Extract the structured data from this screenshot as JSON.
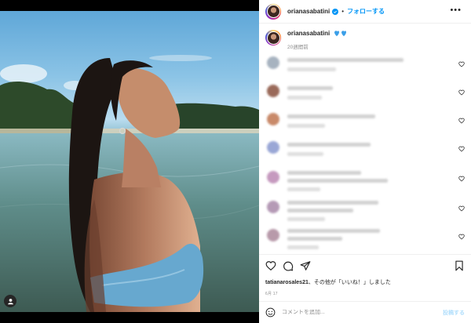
{
  "header": {
    "username": "orianasabatini",
    "separator": "•",
    "follow_label": "フォローする",
    "more_label": "•••"
  },
  "caption": {
    "username": "orianasabatini",
    "time_ago": "20週間前"
  },
  "comments": [
    {
      "avatar_color": "#a7b3c0"
    },
    {
      "avatar_color": "#9a6a5a"
    },
    {
      "avatar_color": "#c98a6a"
    },
    {
      "avatar_color": "#9aa7d6"
    },
    {
      "avatar_color": "#c69abf"
    },
    {
      "avatar_color": "#b59ab6"
    },
    {
      "avatar_color": "#b89aaa"
    }
  ],
  "likes": {
    "user": "tatianarosales21",
    "text": "、その他が「いいね！」しました"
  },
  "post_date": "6月 17",
  "add_comment": {
    "placeholder": "コメントを追加...",
    "post_label": "投稿する"
  },
  "colors": {
    "accent": "#0095f6",
    "post_disabled": "#b2dffc",
    "text": "#262626",
    "muted": "#8e8e8e"
  }
}
